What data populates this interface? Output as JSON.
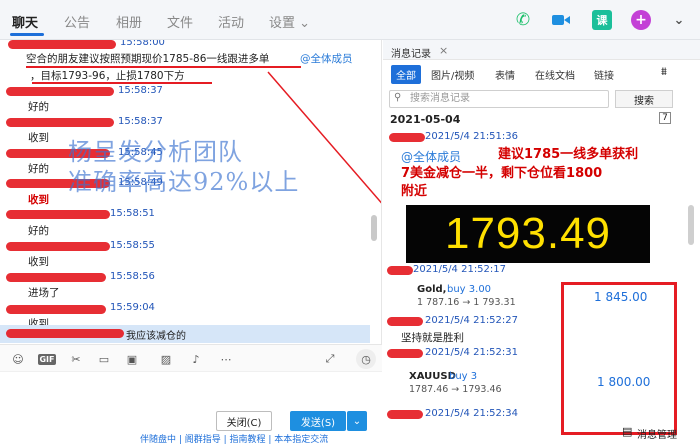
{
  "nav": {
    "tabs": [
      "聊天",
      "公告",
      "相册",
      "文件",
      "活动",
      "设置 ⌄"
    ],
    "active": 0,
    "icons": [
      {
        "name": "phone-icon",
        "color": "#1bbf6a",
        "glyph": "✆"
      },
      {
        "name": "video-icon",
        "color": "#1e8fe0",
        "glyph": "▶"
      },
      {
        "name": "class-icon",
        "color": "#1bbf9a",
        "glyph": "课"
      },
      {
        "name": "add-icon",
        "color": "#c340d6",
        "glyph": "+"
      },
      {
        "name": "more-icon",
        "color": "#555555",
        "glyph": "⌄"
      }
    ]
  },
  "chat": {
    "ts1": "15:58:00",
    "msg1_line1": "空合的朋友建议按照预期现价1785-86一线跟进多单",
    "mention": "@全体成员",
    "msg1_line2": "，目标1793-96，止损1780下方",
    "ts2": "15:58:37",
    "msg2": "好的",
    "ts3": "15:58:37",
    "msg3": "收到",
    "ts4": "15:58:45",
    "msg4": "好的",
    "ts5": "15:58:49",
    "msg5": "收到",
    "ts6": "15:58:51",
    "msg6": "好的",
    "ts7": "15:58:55",
    "msg7": "收到",
    "ts8": "15:58:56",
    "msg8": "进场了",
    "ts9": "15:59:04",
    "msg9": "收到",
    "msg10": "我应该减仓的",
    "overlay_line1": "杨呈发分析团队",
    "overlay_line2": "准确率高达92%以上"
  },
  "input": {
    "close_label": "关闭(C)",
    "send_label": "发送(S)",
    "send_arrow": "⌄"
  },
  "bottom_strip": "伴随盘中 | 阁群指导 | 指南教程 | 本本指定交流",
  "history": {
    "title": "消息记录",
    "close": "×",
    "filters": [
      "全部",
      "图片/视频",
      "表情",
      "在线文档",
      "链接"
    ],
    "search_placeholder": "搜索消息记录",
    "search_button": "搜索",
    "date": "2021-05-04",
    "ts1": "2021/5/4 21:51:36",
    "mention": "@全体成员",
    "big_msg_l1": "建议1785一线多单获利",
    "big_msg_l2": "7美金减仓一半，剩下仓位看1800",
    "big_msg_l3": "附近",
    "price": "1793.49",
    "ts2": "2021/5/4 21:52:17",
    "card1_title": "Gold,",
    "card1_buy": "buy 3.00",
    "card1_sub": "1 787.16 → 1 793.31",
    "card1_value": "1 845.00",
    "ts3": "2021/5/4 21:52:27",
    "msg_win": "坚持就是胜利",
    "ts4": "2021/5/4 21:52:31",
    "card2_title": "XAUUSD",
    "card2_buy": "buy 3",
    "card2_sub": "1787.46 → 1793.46",
    "card2_value": "1 800.00",
    "ts5": "2021/5/4 21:52:34",
    "footer": "消息管理"
  }
}
